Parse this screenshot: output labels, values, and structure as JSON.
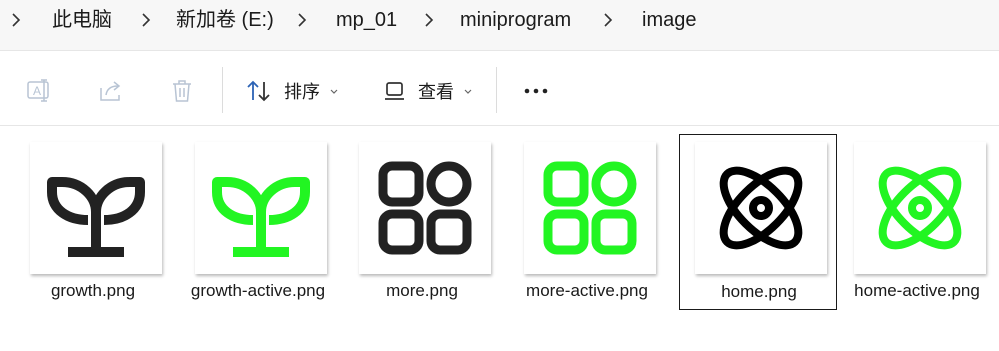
{
  "breadcrumb": {
    "items": [
      "此电脑",
      "新加卷 (E:)",
      "mp_01",
      "miniprogram",
      "image"
    ]
  },
  "toolbar": {
    "rename_icon": "rename-icon",
    "share_icon": "share-icon",
    "delete_icon": "trash-icon",
    "sort_label": "排序",
    "view_label": "查看",
    "more_label": "···"
  },
  "files": [
    {
      "name": "growth.png",
      "icon": "sprout",
      "color": "#222222"
    },
    {
      "name": "growth-active.png",
      "icon": "sprout",
      "color": "#22f522"
    },
    {
      "name": "more.png",
      "icon": "grid-circle",
      "color": "#222222"
    },
    {
      "name": "more-active.png",
      "icon": "grid-circle",
      "color": "#22f522"
    },
    {
      "name": "home.png",
      "icon": "atom",
      "color": "#000000",
      "selected": true
    },
    {
      "name": "home-active.png",
      "icon": "atom",
      "color": "#22f522"
    }
  ]
}
